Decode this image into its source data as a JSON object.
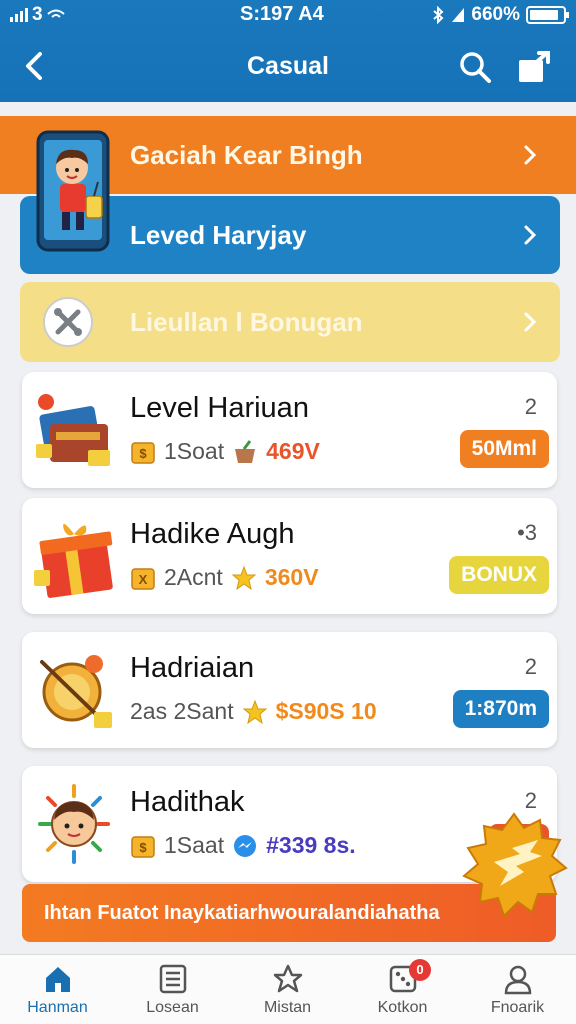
{
  "status_bar": {
    "left_text": "3",
    "time": "S:197 A4",
    "battery": "660%"
  },
  "header": {
    "title": "Casual"
  },
  "banners": [
    {
      "label": "Gaciah Kear Bingh"
    },
    {
      "label": "Leved Haryjay"
    },
    {
      "label": "Lieullan l Bonugan"
    }
  ],
  "cards": [
    {
      "title": "Level Hariuan",
      "count": "2",
      "meta_a": "1Soat",
      "value": "469V",
      "value_color": "#e8552b",
      "pill": "50Mml",
      "pill_color": "#f07f22"
    },
    {
      "title": "Hadike Augh",
      "count": "•3",
      "meta_a": "2Acnt",
      "value": "360V",
      "value_color": "#f08a1c",
      "pill": "BONUX",
      "pill_color": "#e7d53e"
    },
    {
      "title": "Hadriaian",
      "count": "2",
      "meta_a": "2as 2Sant",
      "value": "$S90S 10",
      "value_color": "#f08a1c",
      "pill": "1:870m",
      "pill_color": "#1f7fc3"
    },
    {
      "title": "Hadithak",
      "count": "2",
      "meta_a": "1Saat",
      "value": "#339 8s.",
      "value_color": "#4a3cc0",
      "pill": "",
      "pill_color": "#e8552b"
    }
  ],
  "promo": {
    "text": "Ihtan Fuatot Inaykatiarhwouralandiahatha"
  },
  "bottom_nav": [
    {
      "label": "Hanman",
      "icon": "home-icon",
      "active": true
    },
    {
      "label": "Losean",
      "icon": "list-icon",
      "active": false
    },
    {
      "label": "Mistan",
      "icon": "star-icon",
      "active": false
    },
    {
      "label": "Kotkon",
      "icon": "dice-icon",
      "active": false,
      "badge": "0"
    },
    {
      "label": "Fnoarik",
      "icon": "profile-icon",
      "active": false
    }
  ],
  "colors": {
    "header_blue": "#1a78bd",
    "orange": "#f07f22",
    "blue_banner": "#1f82c4",
    "yellow_banner": "#f5de88"
  }
}
